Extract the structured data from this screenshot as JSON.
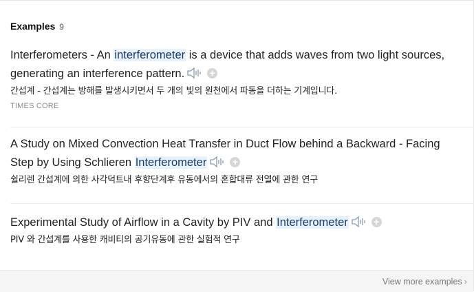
{
  "header": {
    "title": "Examples",
    "count": "9"
  },
  "examples": [
    {
      "en_before": "Interferometers - An ",
      "en_highlight": "interferometer",
      "en_after": " is a device that adds waves from two light sources, generating an interference pattern.",
      "ko": "간섭계 - 간섭계는 방해를 발생시키면서 두 개의 빛의 원천에서 파동을 더하는 기계입니다.",
      "source": "TIMES CORE"
    },
    {
      "en_before": "A Study on Mixed Convection Heat Transfer in Duct Flow behind a Backward - Facing Step by Using Schlieren ",
      "en_highlight": "Interferometer",
      "en_after": "",
      "ko": "쉴리렌 간섭계에 의한 사각덕트내 후향단계후 유동에서의 혼합대류 전열에 관한 연구"
    },
    {
      "en_before": "Experimental Study of Airflow in a Cavity by PIV and ",
      "en_highlight": "Interferometer",
      "en_after": "",
      "ko": "PIV 와 간섭계를 사용한 캐비티의 공기유동에 관한 실험적 연구"
    }
  ],
  "footer": {
    "view_more": "View more examples",
    "chevron": "›"
  },
  "icons": {
    "speaker": "speaker-icon",
    "add": "add-icon"
  },
  "colors": {
    "highlight_bg": "#e6f1fb",
    "add_icon": "#d6d6d6"
  }
}
